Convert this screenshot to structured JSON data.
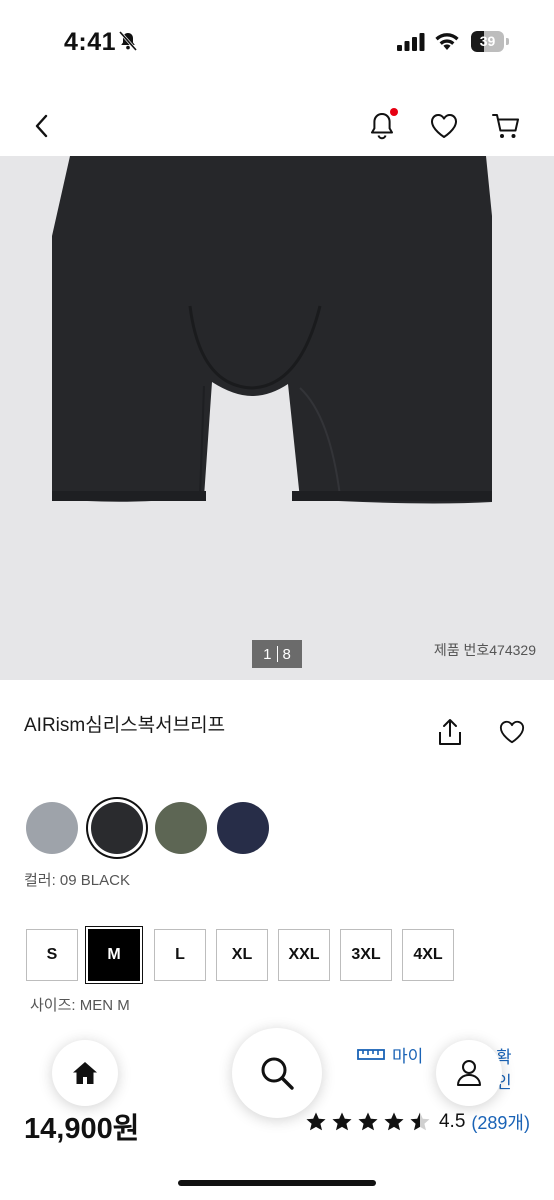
{
  "status_bar": {
    "time": "4:41",
    "battery": "39"
  },
  "product": {
    "image_counter_current": "1",
    "image_counter_total": "8",
    "product_code": "제품 번호474329",
    "title": "AIRism심리스복서브리프"
  },
  "colors": {
    "swatches": [
      {
        "name": "gray",
        "hex": "#9ea3aa"
      },
      {
        "name": "black",
        "hex": "#2a2b2e"
      },
      {
        "name": "olive",
        "hex": "#5d6654"
      },
      {
        "name": "navy",
        "hex": "#272d48"
      }
    ],
    "selected_label": "컬러: 09 BLACK"
  },
  "sizes": {
    "options": [
      "S",
      "M",
      "L",
      "XL",
      "XXL",
      "3XL",
      "4XL"
    ],
    "selected": "M",
    "selected_label": "사이즈: MEN M"
  },
  "fit": {
    "label_start": "마이",
    "label_end": "확인"
  },
  "price": "14,900원",
  "rating": {
    "value": "4.5",
    "stars": 4.5,
    "count": "(289개)"
  },
  "theme": {
    "accent": "#e60012",
    "link": "#1a63b6"
  }
}
